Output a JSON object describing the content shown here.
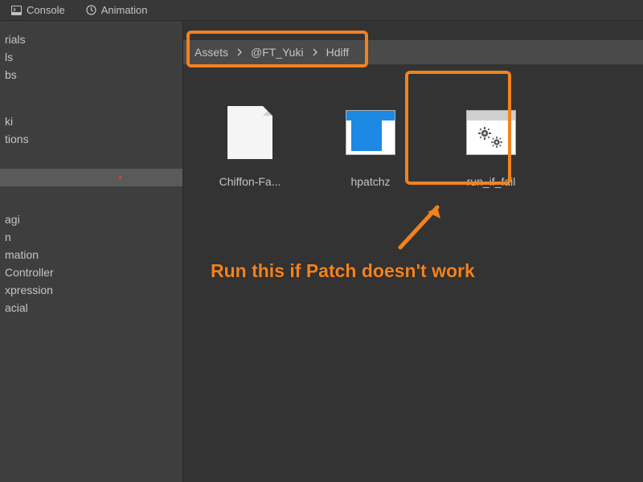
{
  "tabs": {
    "console": "Console",
    "animation": "Animation"
  },
  "sidebar": {
    "items": [
      "rials",
      "ls",
      "bs"
    ],
    "items2": [
      "ki",
      "tions"
    ],
    "items3": [
      "agi",
      "n",
      "mation",
      "Controller",
      "xpression",
      "acial"
    ]
  },
  "breadcrumb": {
    "root": "Assets",
    "mid": "@FT_Yuki",
    "leaf": "Hdiff"
  },
  "assets": {
    "a0": "Chiffon-Fa...",
    "a1": "hpatchz",
    "a2": "run_if_fail"
  },
  "annotation": {
    "text": "Run this if Patch doesn't work"
  }
}
